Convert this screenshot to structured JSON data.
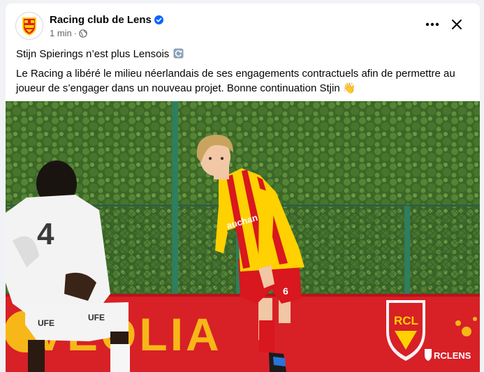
{
  "post": {
    "page_name": "Racing club de Lens",
    "timestamp": "1 min",
    "separator": "·",
    "audience_icon": "globe-icon",
    "title": "Stijn Spierings n’est plus Lensois",
    "title_emoji": "refresh-emoji",
    "body": "Le Racing a libéré le milieu néerlandais de ses engagements contractuels afin de permettre au joueur de s’engager dans un nouveau projet. Bonne continuation Stjin 👋",
    "more_icon": "more-options-icon",
    "close_icon": "close-icon"
  },
  "photo": {
    "sponsor_board": "VEOLIA",
    "watermark": "RCLENS",
    "player_shirt_sponsor": "auchan",
    "player_number": "6",
    "opponent_number": "4",
    "opponent_sponsor": "UFE"
  },
  "colors": {
    "brand_blue": "#0866ff",
    "text_primary": "#050505",
    "text_secondary": "#65676b",
    "lens_red": "#e11b22",
    "lens_yellow": "#ffd100"
  }
}
